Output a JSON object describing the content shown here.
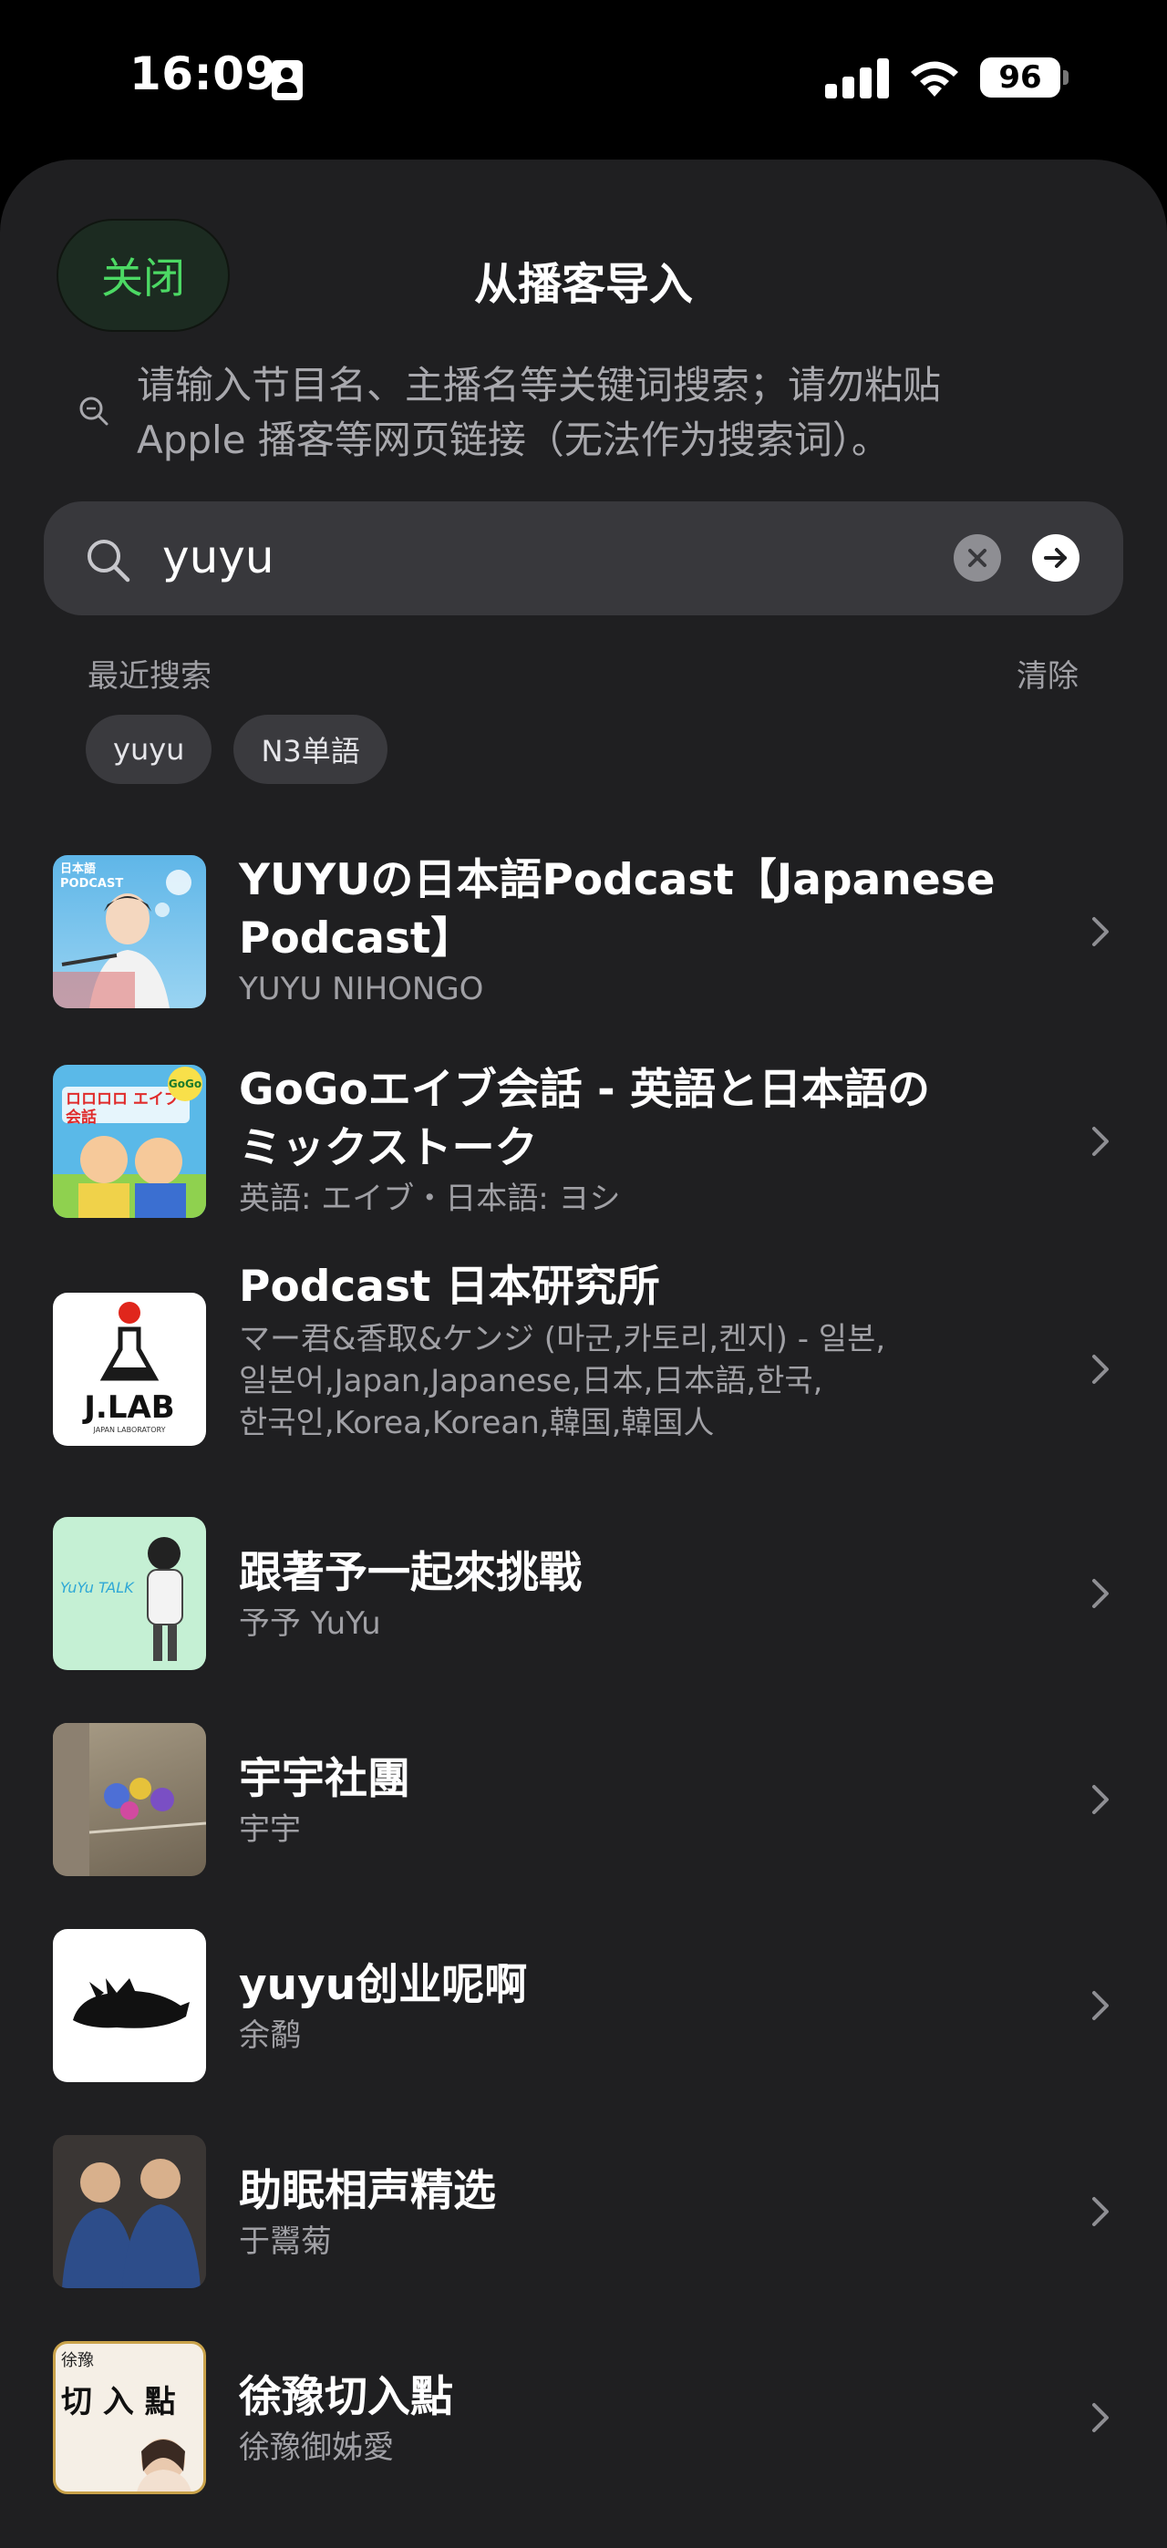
{
  "status_bar": {
    "time": "16:09",
    "battery": "96"
  },
  "header": {
    "close_label": "关闭",
    "title": "从播客导入"
  },
  "hint": {
    "line1": "请输入节目名、主播名等关键词搜索；请勿粘贴",
    "line2": "Apple 播客等网页链接（无法作为搜索词）。"
  },
  "search": {
    "value": "yuyu"
  },
  "recent": {
    "label": "最近搜索",
    "clear_label": "清除",
    "chips": [
      "yuyu",
      "N3单語"
    ]
  },
  "results": [
    {
      "title_line1": "YUYUの日本語Podcast【Japanese",
      "title_line2": "Podcast】",
      "subtitle": "YUYU NIHONGO"
    },
    {
      "title_line1": "GoGoエイブ会話 - 英語と日本語の",
      "title_line2": "ミックストーク",
      "subtitle": "英語: エイブ・日本語: ヨシ"
    },
    {
      "title_line1": "Podcast 日本研究所",
      "sub_line1": "マー君&香取&ケンジ (마군,카토리,켄지) - 일본,",
      "sub_line2": "일본어,Japan,Japanese,日本,日本語,한국,",
      "sub_line3": "한국인,Korea,Korean,韓国,韓国人"
    },
    {
      "title_line1": "跟著予一起來挑戰",
      "subtitle": "予予 YuYu"
    },
    {
      "title_line1": "宇宇社團",
      "subtitle": "宇宇"
    },
    {
      "title_line1": "yuyu创业呢啊",
      "subtitle": "余鹬"
    },
    {
      "title_line1": "助眠相声精选",
      "subtitle": "于鬻菊"
    },
    {
      "title_line1": "徐豫切入點",
      "subtitle": "徐豫御姊愛"
    }
  ],
  "covers": {
    "c1_text": "日本語 PODCAST",
    "c2_text": "ロロロロ エイブ会話",
    "c2_badge": "GoGo",
    "c3_text": "J.LAB",
    "c3_sub": "JAPAN LABORATORY",
    "c4_text": "YuYu TALK",
    "c8_text1": "徐豫",
    "c8_text2": "切 入 點"
  }
}
